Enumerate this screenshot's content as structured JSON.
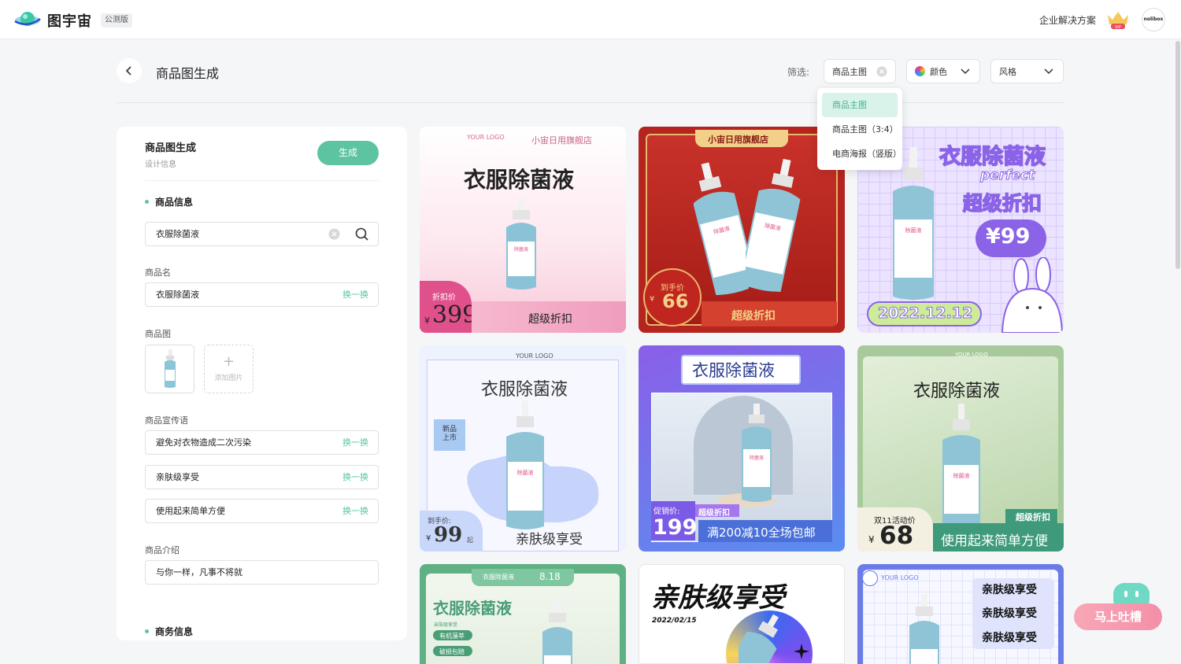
{
  "topbar": {
    "brand": "图宇宙",
    "badge": "公测版",
    "enterprise": "企业解决方案",
    "vip": "VIP",
    "avatar": "nolibox"
  },
  "header": {
    "title": "商品图生成",
    "filter_label": "筛选:",
    "filter_type": "商品主图",
    "filter_color": "颜色",
    "filter_style": "风格"
  },
  "dropdown": {
    "options": [
      "商品主图",
      "商品主图（3:4）",
      "电商海报（竖版）"
    ]
  },
  "panel": {
    "title": "商品图生成",
    "subtitle": "设计信息",
    "generate": "生成",
    "section_product": "商品信息",
    "search_value": "衣服除菌液",
    "name_label": "商品名",
    "name_value": "衣服除菌液",
    "swap": "换一换",
    "image_label": "商品图",
    "add_image": "添加图片",
    "slogan_label": "商品宣传语",
    "slogans": [
      "避免对衣物造成二次污染",
      "亲肤级享受",
      "使用起来简单方便"
    ],
    "intro_label": "商品介绍",
    "intro_value": "与你一样，凡事不将就",
    "section_business": "商务信息"
  },
  "cards": {
    "c1": {
      "logo": "YOUR LOGO",
      "shop": "小宙日用旗舰店",
      "title": "衣服除菌液",
      "price_label": "折扣价",
      "currency": "¥",
      "price": "399",
      "tag": "超级折扣"
    },
    "c2": {
      "shop": "小宙日用旗舰店",
      "price_label": "到手价",
      "currency": "¥",
      "price": "66",
      "tag": "超级折扣"
    },
    "c3": {
      "title": "衣服除菌液",
      "sub": "perfect",
      "tag": "超级折扣",
      "price": "¥99",
      "date": "2022.12.12"
    },
    "c4": {
      "logo": "YOUR LOGO",
      "title": "衣服除菌液",
      "badge": "新品上市",
      "price_label": "到手价:",
      "currency": "¥",
      "price": "99",
      "unit": "起",
      "slogan": "亲肤级享受"
    },
    "c5": {
      "title": "衣服除菌液",
      "price_label": "促销价:",
      "tag": "超级折扣",
      "price": "199",
      "promo": "满200减10全场包邮"
    },
    "c6": {
      "logo": "YOUR LOGO",
      "title": "衣服除菌液",
      "event": "双11活动价",
      "currency": "¥",
      "price": "68",
      "tag": "超级折扣",
      "slogan": "使用起来简单方便"
    },
    "c7": {
      "top": "衣服除菌液",
      "date": "8.18",
      "title": "衣服除菌液",
      "sub": "亲肤级享受",
      "tag1": "有机藻萃",
      "tag2": "破损包赔"
    },
    "c8": {
      "title": "亲肤级享受",
      "date": "2022/02/15"
    },
    "c9": {
      "logo": "YOUR LOGO",
      "line1": "亲肤级享受",
      "line2": "亲肤级享受",
      "line3": "亲肤级享受"
    }
  },
  "label_text": "除菌液",
  "fab": {
    "label": "马上吐槽"
  },
  "colors": {
    "accent": "#5cc4a0",
    "pink": "#e0508a",
    "red": "#b5241e",
    "purple": "#8a63e6"
  }
}
